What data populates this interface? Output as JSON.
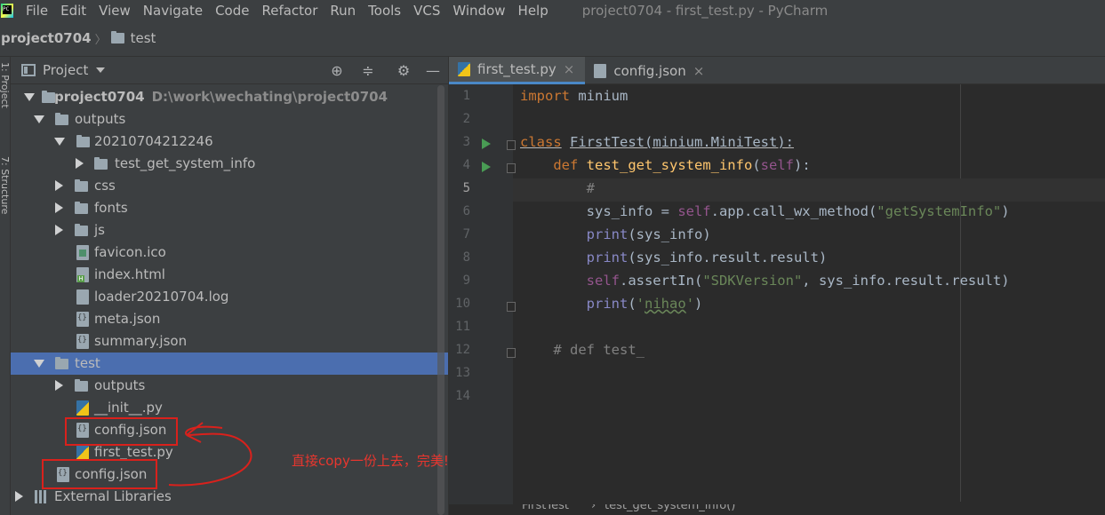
{
  "app": {
    "logo_text": "PC",
    "window_title": "project0704 - first_test.py - PyCharm"
  },
  "menu": [
    "File",
    "Edit",
    "View",
    "Navigate",
    "Code",
    "Refactor",
    "Run",
    "Tools",
    "VCS",
    "Window",
    "Help"
  ],
  "navbar": {
    "project": "project0704",
    "folder": "test"
  },
  "left_strip": {
    "project_label": "1: Project",
    "structure_label": "7: Structure"
  },
  "project_panel": {
    "title": "Project",
    "tree": [
      {
        "label": "project0704",
        "path": "D:\\work\\wechating\\project0704"
      },
      {
        "label": "outputs"
      },
      {
        "label": "20210704212246"
      },
      {
        "label": "test_get_system_info"
      },
      {
        "label": "css"
      },
      {
        "label": "fonts"
      },
      {
        "label": "js"
      },
      {
        "label": "favicon.ico"
      },
      {
        "label": "index.html"
      },
      {
        "label": "loader20210704.log"
      },
      {
        "label": "meta.json"
      },
      {
        "label": "summary.json"
      },
      {
        "label": "test"
      },
      {
        "label": "outputs"
      },
      {
        "label": "__init__.py"
      },
      {
        "label": "config.json"
      },
      {
        "label": "first_test.py"
      },
      {
        "label": "config.json"
      },
      {
        "label": "External Libraries"
      }
    ]
  },
  "annotation": {
    "text": "直接copy一份上去，完美!",
    "color": "#e8362e"
  },
  "editor": {
    "tabs": [
      {
        "label": "first_test.py",
        "active": true
      },
      {
        "label": "config.json",
        "active": false
      }
    ],
    "line_numbers": [
      "1",
      "2",
      "3",
      "4",
      "5",
      "6",
      "7",
      "8",
      "9",
      "10",
      "11",
      "12",
      "13",
      "14"
    ],
    "current_line": "5",
    "code": {
      "l1_kw": "import",
      "l1_rest": " minium",
      "l3_kw": "class",
      "l3_name": "FirstTest",
      "l3_rest": "(minium.MiniTest):",
      "l4_kw": "def",
      "l4_name": "test_get_system_info",
      "l4_self": "self",
      "l4_open": "(",
      "l4_close": "):",
      "l5_cmt": "#",
      "l6_a": "sys_info = ",
      "l6_self": "self",
      "l6_b": ".app.call_wx_method(",
      "l6_str": "\"getSystemInfo\"",
      "l6_c": ")",
      "l7_bi": "print",
      "l7_rest": "(sys_info)",
      "l8_bi": "print",
      "l8_rest": "(sys_info.result.result)",
      "l9_self": "self",
      "l9_a": ".assertIn(",
      "l9_str": "\"SDKVersion\"",
      "l9_b": ", sys_info.result.result)",
      "l10_bi": "print",
      "l10_a": "(",
      "l10_q1": "'",
      "l10_str": "nihao",
      "l10_q2": "'",
      "l10_b": ")",
      "l12_cmt": "# def test_"
    },
    "breadcrumb": [
      "FirstTest",
      "test_get_system_info()"
    ]
  },
  "colors": {
    "accent_selection": "#4b6eaf",
    "tab_underline": "#4a88c7",
    "run_marker": "#499c54",
    "annotation_red": "#d9211c"
  }
}
